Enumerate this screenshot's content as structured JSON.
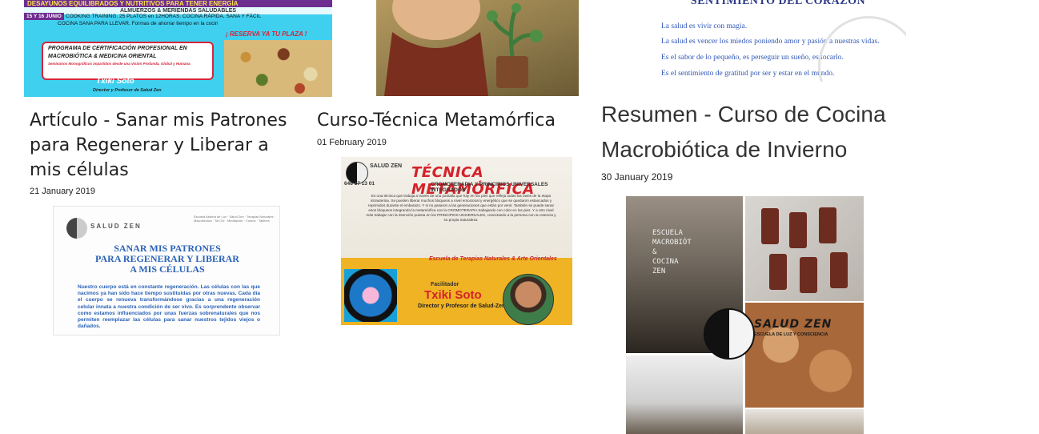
{
  "posts": [
    {
      "title": "Artículo - Sanar mis Patrones para Regenerar y Liberar a mis células",
      "date": "21 January 2019",
      "image": {
        "brand": "SALUD ZEN",
        "heading_lines": [
          "SANAR MIS PATRONES",
          "PARA REGENERAR Y LIBERAR",
          "A MIS CÉLULAS"
        ],
        "body": "Nuestro cuerpo está en constante regeneración. Las células con las que nacimos ya han sido hace tiempo sustituidas por otras nuevas. Cada día el cuerpo se renueva transformándose gracias a una regeneración celular innata a nuestra condición de ser vivo. Es sorprendente observar como estamos influenciados por unas fuerzas sobrenaturales que nos permiten reemplazar las células para sanar nuestros tejidos viejos o dañados."
      }
    },
    {
      "title": "Curso-Técnica Metamórfica",
      "date": "01 February 2019",
      "image": {
        "brand": "SALUD ZEN",
        "phone": "646 17 13 01",
        "heading": "TÉCNICA METAMÓRFICA",
        "subheading": "CROMOTERAPIA Y PRINCIPIOS UNIVERSALES INTEGRADOS",
        "body": "Es una técnica que trabaja a través de una pantalla que hay en los pies que refleja todas las fases de la etapa intrauterina. Se pueden liberar muchos bloqueos a nivel emocional y energético que se quedaron estancados y reprimidos durante el embarazo. Y si no pasaron a las generaciones que están por venir. También se puede sanar esos bloqueos integrando la metamórfica con la CROMOTERAPIA trabajando con color en los pies. Y a otro nivel más trabajar con la intención puesta en los PRINCIPIOS UNIVERSALES, conectando a la persona con su esencia y su propia naturaleza.",
        "school": "Escuela de Terapias Naturales & Arte Orientales",
        "facilitator_label": "Facilitador",
        "facilitator_name": "Txiki Soto",
        "facilitator_role": "Director y Profesor de Salud-Zen"
      }
    },
    {
      "title": "Resumen - Curso de Cocina Macrobiótica de Invierno",
      "date": "30 January 2019",
      "image": {
        "brand": "SALUD ZEN",
        "brand_sub": "ESCUELA DE LUZ Y CONSCIENCIA",
        "chalk_lines": [
          "ESCUELA",
          "MACROBIÓT",
          "&",
          "COCINA",
          "ZEN"
        ]
      }
    }
  ],
  "top_images": {
    "left": {
      "strip_top": "DESAYUNOS EQUILIBRADOS Y NUTRITIVOS PARA TENER ENERGÍA",
      "strip_2": "ALMUERZOS & MERIENDAS SALUDABLES",
      "date_badge": "15 Y 16 JUNIO",
      "line_1": "COOKING TRAINING. 25 PLATOS en 12HORAS. COCINA RÁPIDA, SANA Y FÁCIL",
      "line_2": "COCINA SANA PARA LLEVAR. Formas de ahorrar tiempo en la cocina. Embotados. Cocina Angélica. Preparados para varios días",
      "cert_1": "PROGRAMA DE CERTIFICACIÓN PROFESIONAL EN",
      "cert_2": "MACROBIÓTICA & MEDICINA ORIENTAL",
      "cert_3": "Seminarios Monográficos impartidos desde una Visión Profunda, Global y Humana",
      "cta": "¡ RESERVA YA TU PLAZA !",
      "sign_name": "Txiki Soto",
      "sign_role": "Director y Profesor de Salud Zen"
    },
    "right": {
      "heading": "SENTIMIENTO DEL CORAZÓN",
      "lines": [
        "La salud es vivir con magia.",
        "La salud es vencer los miedos poniendo amor y pasión a nuestras vidas.",
        "Es el sabor de lo pequeño, es perseguir un sueño, es tocarlo.",
        "Es el sentimiento de gratitud por ser y estar en el mundo."
      ]
    }
  },
  "colors": {
    "title_text": "#222222",
    "banner_cyan": "#3fd0f0",
    "accent_red": "#d4222a",
    "quote_blue": "#2f57b8"
  }
}
